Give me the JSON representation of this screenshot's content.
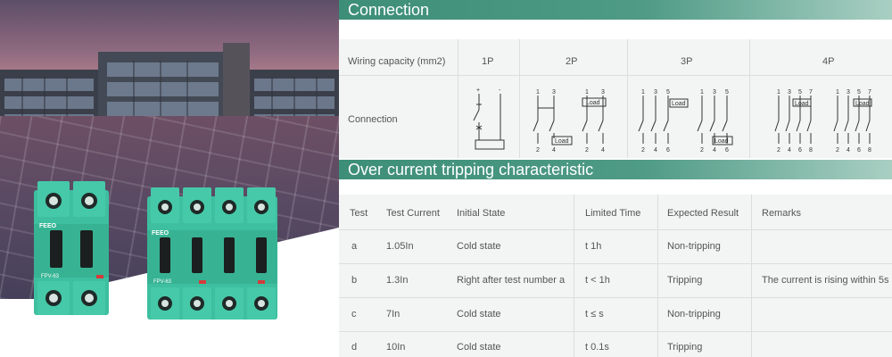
{
  "connection": {
    "title": "Connection",
    "wiring_label": "Wiring capacity (mm2)",
    "row_label": "Connection",
    "poles": [
      "1P",
      "2P",
      "3P",
      "4P"
    ],
    "diagram_load_label": "Load",
    "terminal_numbers_top": [
      "1",
      "3",
      "5",
      "7"
    ],
    "terminal_numbers_bottom": [
      "2",
      "4",
      "6",
      "8"
    ]
  },
  "tripping": {
    "title": "Over current tripping characteristic",
    "headers": [
      "Test",
      "Test Current",
      "Initial State",
      "Limited Time",
      "Expected Result",
      "Remarks"
    ],
    "rows": [
      [
        "a",
        "1.05In",
        "Cold state",
        "t 1h",
        "Non-tripping",
        ""
      ],
      [
        "b",
        "1.3In",
        "Right after test number a",
        "t < 1h",
        "Tripping",
        "The current is rising within 5s"
      ],
      [
        "c",
        "7In",
        "Cold state",
        "t ≤ s",
        "Non-tripping",
        ""
      ],
      [
        "d",
        "10In",
        "Cold state",
        "t 0.1s",
        "Tripping",
        ""
      ]
    ]
  },
  "product": {
    "brand": "FEEO",
    "model_2p": "FPV-63",
    "model_4p": "FPV-63"
  },
  "colors": {
    "header_green": "#3d8e78",
    "breaker_green": "#3dbfa0"
  }
}
